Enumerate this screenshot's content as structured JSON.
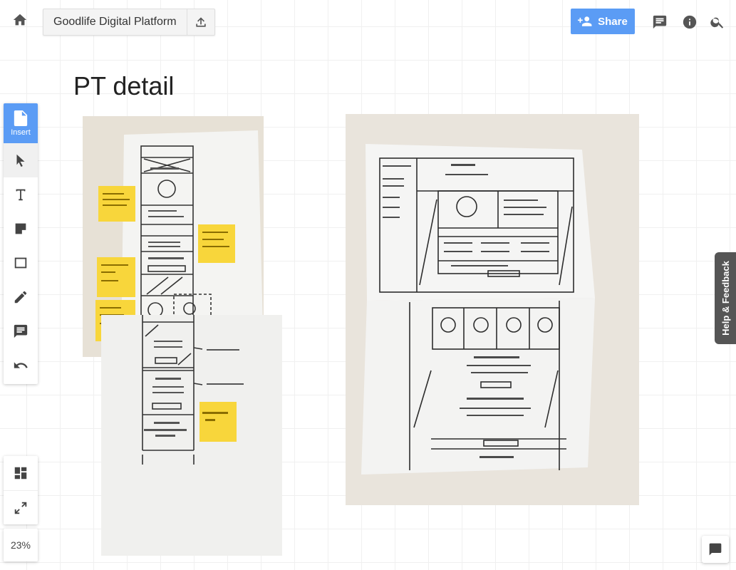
{
  "board": {
    "title": "Goodlife Digital Platform",
    "heading": "PT detail",
    "zoom": "23%"
  },
  "header": {
    "share_label": "Share",
    "icons": [
      "home-icon",
      "upload-icon",
      "share-person-icon",
      "comments-icon",
      "info-icon",
      "search-icon"
    ]
  },
  "toolbar": {
    "insert_label": "Insert",
    "tools": [
      "select",
      "text",
      "sticky-note",
      "shape",
      "pen",
      "comment",
      "undo"
    ]
  },
  "panel": {
    "tools": [
      "layout",
      "fullscreen"
    ]
  },
  "help": {
    "label": "Help & Feedback"
  },
  "colors": {
    "accent": "#5b9cf5",
    "sticky": "#f8d63b",
    "help_tab": "#555555"
  }
}
